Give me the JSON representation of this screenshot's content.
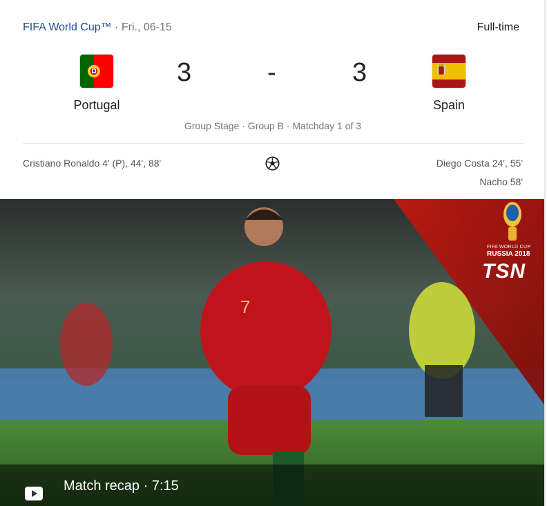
{
  "header": {
    "competition": "FIFA World Cup™",
    "separator": " · ",
    "date": "Fri., 06-15",
    "status": "Full-time"
  },
  "home": {
    "name": "Portugal",
    "score": "3",
    "flag": "portugal-flag-icon"
  },
  "away": {
    "name": "Spain",
    "score": "3",
    "flag": "spain-flag-icon"
  },
  "score_separator": "-",
  "stage": "Group Stage · Group B · Matchday 1 of 3",
  "scorers": {
    "home": "Cristiano Ronaldo 4' (P), 44', 88'",
    "away_lines": [
      "Diego Costa 24', 55'",
      "Nacho 58'"
    ],
    "icon": "soccer-ball-icon"
  },
  "video": {
    "label": "Match recap · 7:15",
    "overlay_brand": "TSN",
    "overlay_event": "FIFA WORLD CUP",
    "overlay_event_sub": "RUSSIA 2018",
    "player_number": "7",
    "play_icon": "play-icon"
  },
  "colors": {
    "link": "#1a4d8f",
    "muted": "#70757a",
    "portugal_green": "#006600",
    "portugal_red": "#ff0000",
    "spain_red": "#aa151b",
    "spain_yellow": "#f1bf00",
    "tsn_red": "#b3120f"
  }
}
